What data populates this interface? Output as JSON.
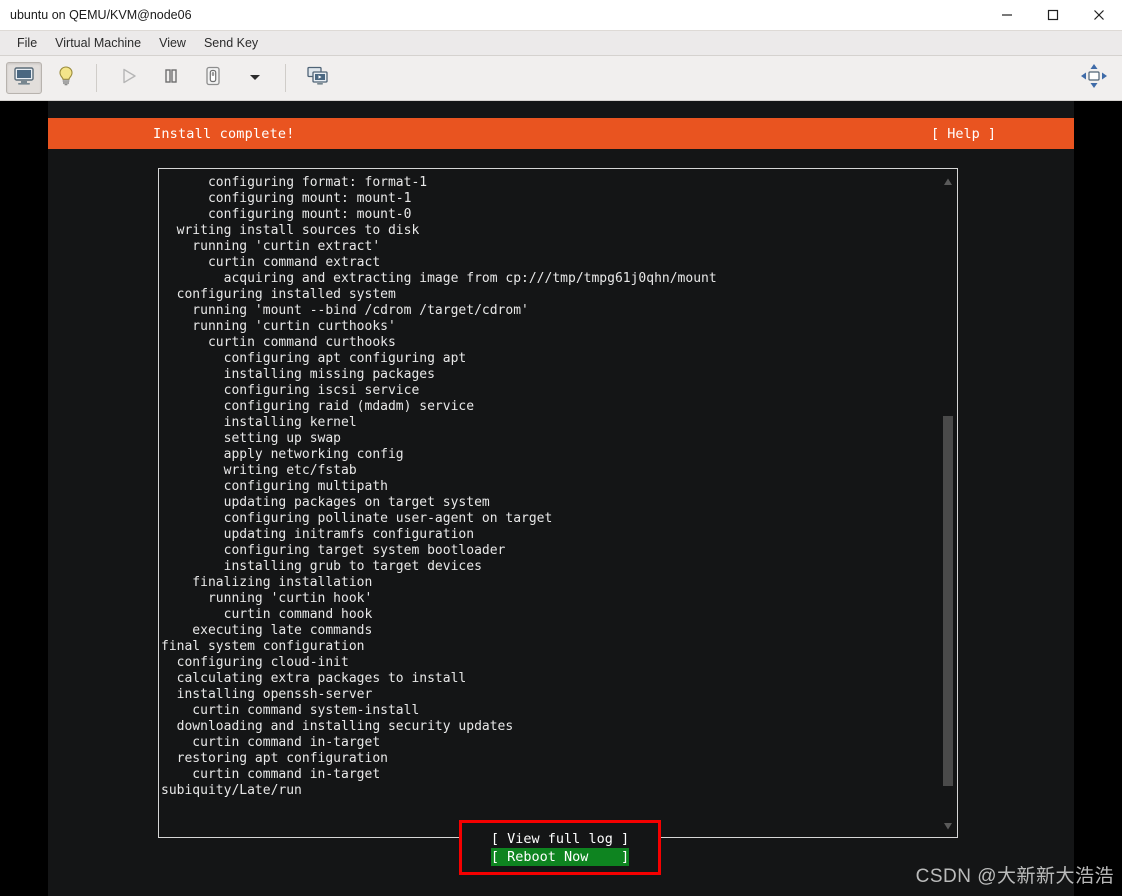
{
  "window": {
    "title": "ubuntu on QEMU/KVM@node06",
    "controls": {
      "minimize": "minimize-button",
      "maximize": "maximize-button",
      "close": "close-button"
    }
  },
  "menubar": {
    "items": [
      {
        "label": "File"
      },
      {
        "label": "Virtual Machine"
      },
      {
        "label": "View"
      },
      {
        "label": "Send Key"
      }
    ]
  },
  "toolbar": {
    "buttons": [
      {
        "name": "show-console-button",
        "icon": "monitor-icon",
        "state": "pressed"
      },
      {
        "name": "show-details-button",
        "icon": "lightbulb-icon",
        "state": "normal"
      },
      {
        "name": "run-button",
        "icon": "play-icon",
        "state": "disabled"
      },
      {
        "name": "pause-button",
        "icon": "pause-icon",
        "state": "normal"
      },
      {
        "name": "shutdown-button",
        "icon": "power-icon",
        "state": "normal"
      },
      {
        "name": "shutdown-menu-button",
        "icon": "chevron-down-icon",
        "state": "normal"
      },
      {
        "name": "snapshots-button",
        "icon": "snapshots-icon",
        "state": "normal"
      },
      {
        "name": "fullscreen-button",
        "icon": "fullscreen-arrows-icon",
        "state": "normal"
      }
    ]
  },
  "installer": {
    "header_title": "Install complete!",
    "help_label": "[ Help ]",
    "log_lines": [
      "      configuring format: format-1",
      "      configuring mount: mount-1",
      "      configuring mount: mount-0",
      "  writing install sources to disk",
      "    running 'curtin extract'",
      "      curtin command extract",
      "        acquiring and extracting image from cp:///tmp/tmpg61j0qhn/mount",
      "  configuring installed system",
      "    running 'mount --bind /cdrom /target/cdrom'",
      "    running 'curtin curthooks'",
      "      curtin command curthooks",
      "        configuring apt configuring apt",
      "        installing missing packages",
      "        configuring iscsi service",
      "        configuring raid (mdadm) service",
      "        installing kernel",
      "        setting up swap",
      "        apply networking config",
      "        writing etc/fstab",
      "        configuring multipath",
      "        updating packages on target system",
      "        configuring pollinate user-agent on target",
      "        updating initramfs configuration",
      "        configuring target system bootloader",
      "        installing grub to target devices",
      "    finalizing installation",
      "      running 'curtin hook'",
      "        curtin command hook",
      "    executing late commands",
      "final system configuration",
      "  configuring cloud-init",
      "  calculating extra packages to install",
      "  installing openssh-server",
      "    curtin command system-install",
      "  downloading and installing security updates",
      "    curtin command in-target",
      "  restoring apt configuration",
      "    curtin command in-target",
      "subiquity/Late/run"
    ],
    "buttons": [
      {
        "label": "[ View full log ]",
        "selected": false
      },
      {
        "label": "[ Reboot Now    ]",
        "selected": true
      }
    ],
    "colors": {
      "header_orange": "#e95420",
      "selected_green": "#0e8420",
      "highlight_red": "#f50000",
      "console_background": "#141516"
    }
  },
  "watermark": {
    "text": "CSDN @大新新大浩浩"
  }
}
